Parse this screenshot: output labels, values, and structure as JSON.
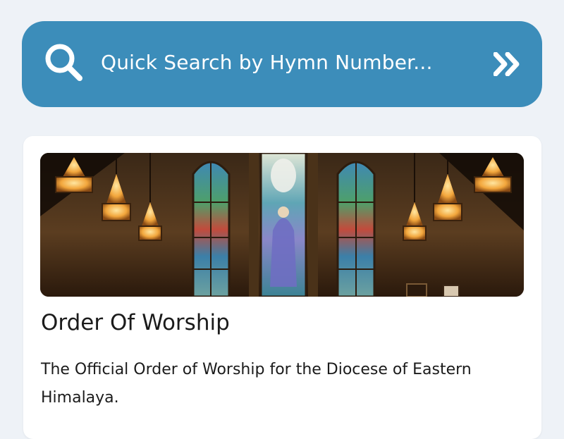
{
  "search": {
    "placeholder": "Quick Search by Hymn Number...",
    "search_icon": "search-icon",
    "go_icon": "double-chevron-right-icon"
  },
  "card": {
    "title": "Order Of Worship",
    "description": "The Official Order of Worship for the Diocese of Eastern Himalaya."
  },
  "colors": {
    "background": "#eef2f7",
    "accent": "#3c8dba",
    "card": "#ffffff",
    "text": "#1b1b1b"
  }
}
